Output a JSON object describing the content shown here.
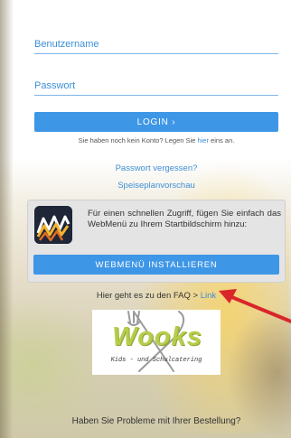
{
  "login": {
    "username_placeholder": "Benutzername",
    "password_placeholder": "Passwort",
    "login_button": "LOGIN ›",
    "register_prefix": "Sie haben noch kein Konto? Legen Sie ",
    "register_link": "hier",
    "register_suffix": " eins an.",
    "forgot_password": "Passwort vergessen?",
    "menu_preview": "Speiseplanvorschau"
  },
  "install": {
    "icon": "webmenu-app-icon",
    "text": "Für einen schnellen Zugriff, fügen Sie einfach das WebMenü zu Ihrem Startbildschirm hinzu:",
    "button": "WEBMENÜ INSTALLIEREN"
  },
  "faq": {
    "prefix": "Hier geht es zu den FAQ > ",
    "link": "Link"
  },
  "logo": {
    "word": "Wooks",
    "subtitle": "Kids - und Schulcatering"
  },
  "footer": {
    "problem_text": "Haben Sie Probleme mit Ihrer Bestellung?"
  },
  "colors": {
    "accent": "#3e96e6",
    "link": "#3d8fd8",
    "annotation_arrow": "#d9262b"
  }
}
